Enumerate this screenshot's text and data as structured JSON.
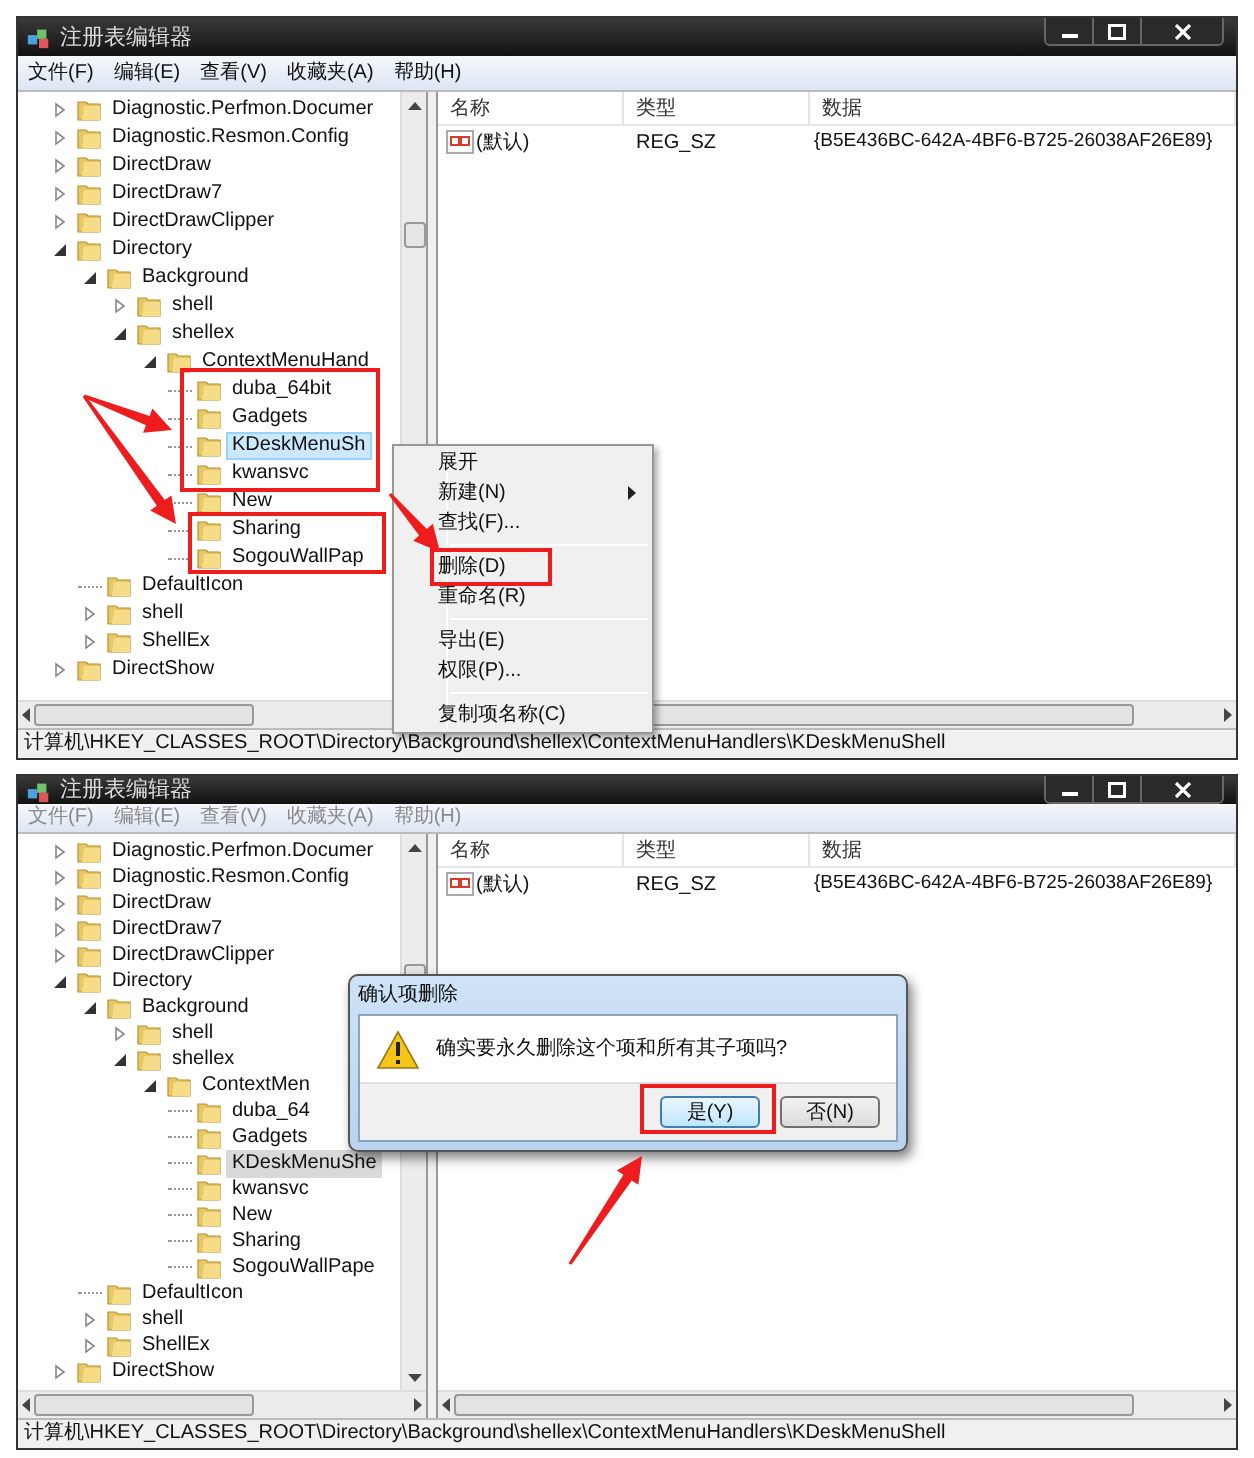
{
  "windows": [
    {
      "title": "注册表编辑器",
      "active": true,
      "menu": [
        {
          "label": "文件(F)",
          "disabled": false
        },
        {
          "label": "编辑(E)",
          "disabled": false
        },
        {
          "label": "查看(V)",
          "disabled": false
        },
        {
          "label": "收藏夹(A)",
          "disabled": false
        },
        {
          "label": "帮助(H)",
          "disabled": false
        }
      ],
      "tree": [
        {
          "label": "Diagnostic.Perfmon.Documer",
          "expanded": false,
          "selected": false
        },
        {
          "label": "Diagnostic.Resmon.Config",
          "expanded": false,
          "selected": false
        },
        {
          "label": "DirectDraw",
          "expanded": false,
          "selected": false
        },
        {
          "label": "DirectDraw7",
          "expanded": false,
          "selected": false
        },
        {
          "label": "DirectDrawClipper",
          "expanded": false,
          "selected": false
        },
        {
          "label": "Directory",
          "expanded": true,
          "selected": false,
          "children": [
            {
              "label": "Background",
              "expanded": true,
              "selected": false,
              "children": [
                {
                  "label": "shell",
                  "expanded": false,
                  "selected": false
                },
                {
                  "label": "shellex",
                  "expanded": true,
                  "selected": false,
                  "children": [
                    {
                      "label": "ContextMenuHand",
                      "expanded": true,
                      "selected": false,
                      "children": [
                        {
                          "label": "duba_64bit",
                          "selected": false
                        },
                        {
                          "label": "Gadgets",
                          "selected": false
                        },
                        {
                          "label": "KDeskMenuSh",
                          "selected": true
                        },
                        {
                          "label": "kwansvc",
                          "selected": false
                        },
                        {
                          "label": "New",
                          "selected": false
                        },
                        {
                          "label": "Sharing",
                          "selected": false
                        },
                        {
                          "label": "SogouWallPap",
                          "selected": false
                        }
                      ]
                    }
                  ]
                }
              ]
            },
            {
              "label": "DefaultIcon",
              "selected": false
            },
            {
              "label": "shell",
              "expanded": false,
              "selected": false
            },
            {
              "label": "ShellEx",
              "expanded": false,
              "selected": false
            }
          ]
        },
        {
          "label": "DirectShow",
          "expanded": false,
          "selected": false
        }
      ],
      "columns": [
        "名称",
        "类型",
        "数据"
      ],
      "rows": [
        {
          "name": "(默认)",
          "type": "REG_SZ",
          "data": "{B5E436BC-642A-4BF6-B725-26038AF26E89}"
        }
      ],
      "status_bar": "计算机\\HKEY_CLASSES_ROOT\\Directory\\Background\\shellex\\ContextMenuHandlers\\KDeskMenuShell",
      "context_menu": {
        "items": [
          {
            "kind": "item",
            "label": "展开",
            "submenu": false
          },
          {
            "kind": "item",
            "label": "新建(N)",
            "submenu": true
          },
          {
            "kind": "item",
            "label": "查找(F)...",
            "submenu": false
          },
          {
            "kind": "separator"
          },
          {
            "kind": "item",
            "label": "删除(D)",
            "submenu": false
          },
          {
            "kind": "item",
            "label": "重命名(R)",
            "submenu": false
          },
          {
            "kind": "separator"
          },
          {
            "kind": "item",
            "label": "导出(E)",
            "submenu": false
          },
          {
            "kind": "item",
            "label": "权限(P)...",
            "submenu": false
          },
          {
            "kind": "separator"
          },
          {
            "kind": "item",
            "label": "复制项名称(C)",
            "submenu": false
          }
        ]
      }
    },
    {
      "title": "注册表编辑器",
      "active": false,
      "menu": [
        {
          "label": "文件(F)",
          "disabled": true
        },
        {
          "label": "编辑(E)",
          "disabled": true
        },
        {
          "label": "查看(V)",
          "disabled": true
        },
        {
          "label": "收藏夹(A)",
          "disabled": true
        },
        {
          "label": "帮助(H)",
          "disabled": true
        }
      ],
      "tree": [
        {
          "label": "Diagnostic.Perfmon.Documer",
          "expanded": false,
          "selected": false
        },
        {
          "label": "Diagnostic.Resmon.Config",
          "expanded": false,
          "selected": false
        },
        {
          "label": "DirectDraw",
          "expanded": false,
          "selected": false
        },
        {
          "label": "DirectDraw7",
          "expanded": false,
          "selected": false
        },
        {
          "label": "DirectDrawClipper",
          "expanded": false,
          "selected": false
        },
        {
          "label": "Directory",
          "expanded": true,
          "selected": false,
          "children": [
            {
              "label": "Background",
              "expanded": true,
              "selected": false,
              "children": [
                {
                  "label": "shell",
                  "expanded": false,
                  "selected": false
                },
                {
                  "label": "shellex",
                  "expanded": true,
                  "selected": false,
                  "children": [
                    {
                      "label": "ContextMen",
                      "expanded": true,
                      "selected": false,
                      "children": [
                        {
                          "label": "duba_64",
                          "selected": false
                        },
                        {
                          "label": "Gadgets",
                          "selected": false
                        },
                        {
                          "label": "KDeskMenuShe",
                          "selected": true
                        },
                        {
                          "label": "kwansvc",
                          "selected": false
                        },
                        {
                          "label": "New",
                          "selected": false
                        },
                        {
                          "label": "Sharing",
                          "selected": false
                        },
                        {
                          "label": "SogouWallPape",
                          "selected": false
                        }
                      ]
                    }
                  ]
                }
              ]
            },
            {
              "label": "DefaultIcon",
              "selected": false
            },
            {
              "label": "shell",
              "expanded": false,
              "selected": false
            },
            {
              "label": "ShellEx",
              "expanded": false,
              "selected": false
            }
          ]
        },
        {
          "label": "DirectShow",
          "expanded": false,
          "selected": false
        }
      ],
      "columns": [
        "名称",
        "类型",
        "数据"
      ],
      "rows": [
        {
          "name": "(默认)",
          "type": "REG_SZ",
          "data": "{B5E436BC-642A-4BF6-B725-26038AF26E89}"
        }
      ],
      "status_bar": "计算机\\HKEY_CLASSES_ROOT\\Directory\\Background\\shellex\\ContextMenuHandlers\\KDeskMenuShell",
      "dialog": {
        "title": "确认项删除",
        "message": "确实要永久删除这个项和所有其子项吗?",
        "buttons": [
          {
            "label": "是(Y)",
            "focused": true
          },
          {
            "label": "否(N)",
            "focused": false
          }
        ]
      }
    }
  ]
}
